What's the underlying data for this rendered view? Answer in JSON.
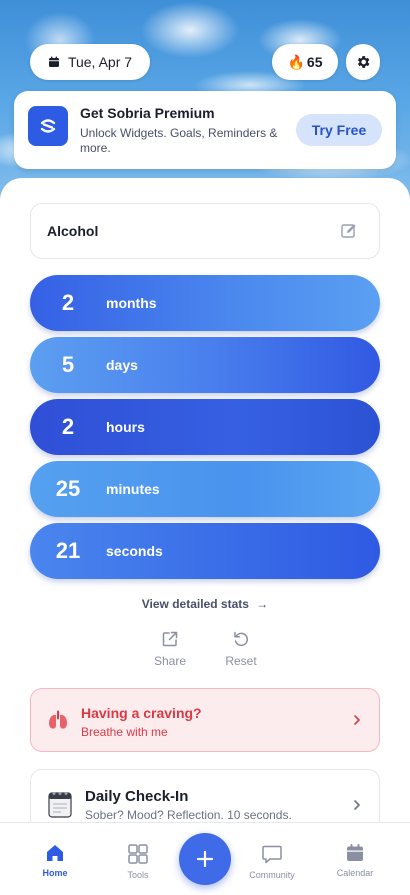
{
  "header": {
    "date": "Tue, Apr 7",
    "streak_count": "65",
    "streak_icon": "flame-icon",
    "settings_icon": "gear-icon"
  },
  "premium": {
    "title": "Get Sobria Premium",
    "subtitle": "Unlock Widgets. Goals, Reminders & more.",
    "button": "Try Free",
    "accent": "#2d5be3"
  },
  "sobriety": {
    "label": "Alcohol",
    "edit_icon": "pencil-icon"
  },
  "counter": [
    {
      "value": "2",
      "unit": "months"
    },
    {
      "value": "5",
      "unit": "days"
    },
    {
      "value": "2",
      "unit": "hours"
    },
    {
      "value": "25",
      "unit": "minutes"
    },
    {
      "value": "21",
      "unit": "seconds"
    }
  ],
  "stats": {
    "link": "View detailed stats",
    "arrow": "→"
  },
  "actions": {
    "share": "Share",
    "reset": "Reset"
  },
  "craving": {
    "title": "Having a craving?",
    "subtitle": "Breathe with me",
    "color": "#d93a45"
  },
  "checkin": {
    "title": "Daily Check-In",
    "subtitle": "Sober? Mood? Reflection. 10 seconds."
  },
  "nav": {
    "home": "Home",
    "tools": "Tools",
    "community": "Community",
    "calendar": "Calendar",
    "active": "Home",
    "active_color": "#2d5be3"
  }
}
